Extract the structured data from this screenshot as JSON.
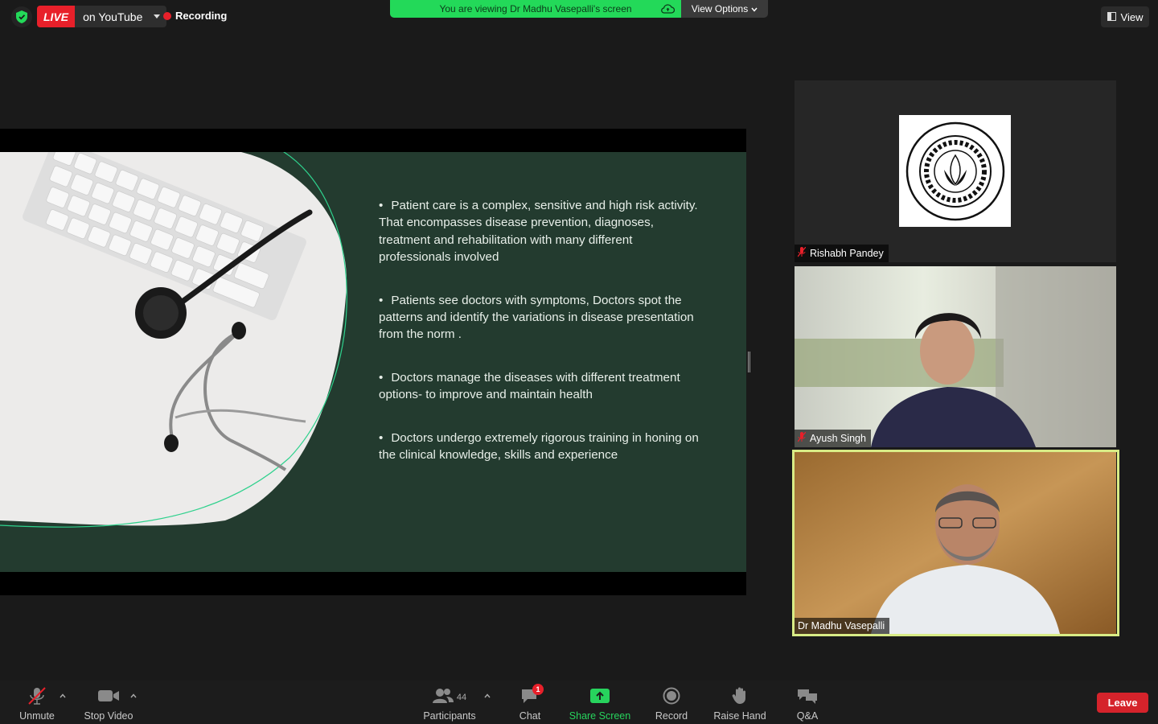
{
  "top_bar": {
    "live_label": "LIVE",
    "live_destination": "on YouTube",
    "recording_label": "Recording",
    "viewing_banner": "You are viewing Dr Madhu Vasepalli's screen",
    "view_options_label": "View Options",
    "view_button_label": "View"
  },
  "slide": {
    "bullets": [
      "Patient care is a complex, sensitive and high risk activity. That encompasses disease prevention, diagnoses, treatment and rehabilitation with many different professionals involved",
      "Patients see doctors with symptoms, Doctors spot the patterns and identify the variations in disease presentation from the norm .",
      "Doctors manage the diseases with different treatment options- to improve and maintain health",
      "Doctors undergo extremely rigorous training in honing on the clinical knowledge, skills and experience"
    ]
  },
  "participants": [
    {
      "name": "Rishabh Pandey",
      "muted": true
    },
    {
      "name": "Ayush Singh",
      "muted": true
    },
    {
      "name": "Dr Madhu Vasepalli",
      "muted": false,
      "active_speaker": true
    }
  ],
  "toolbar": {
    "unmute_label": "Unmute",
    "stop_video_label": "Stop Video",
    "participants_label": "Participants",
    "participants_count": "44",
    "chat_label": "Chat",
    "chat_badge": "1",
    "share_screen_label": "Share Screen",
    "record_label": "Record",
    "raise_hand_label": "Raise Hand",
    "qa_label": "Q&A",
    "leave_label": "Leave"
  },
  "colors": {
    "live_red": "#e8202a",
    "share_green": "#27d35d",
    "speaker_highlight": "#d8ec86",
    "slide_bg": "#233b2f"
  }
}
